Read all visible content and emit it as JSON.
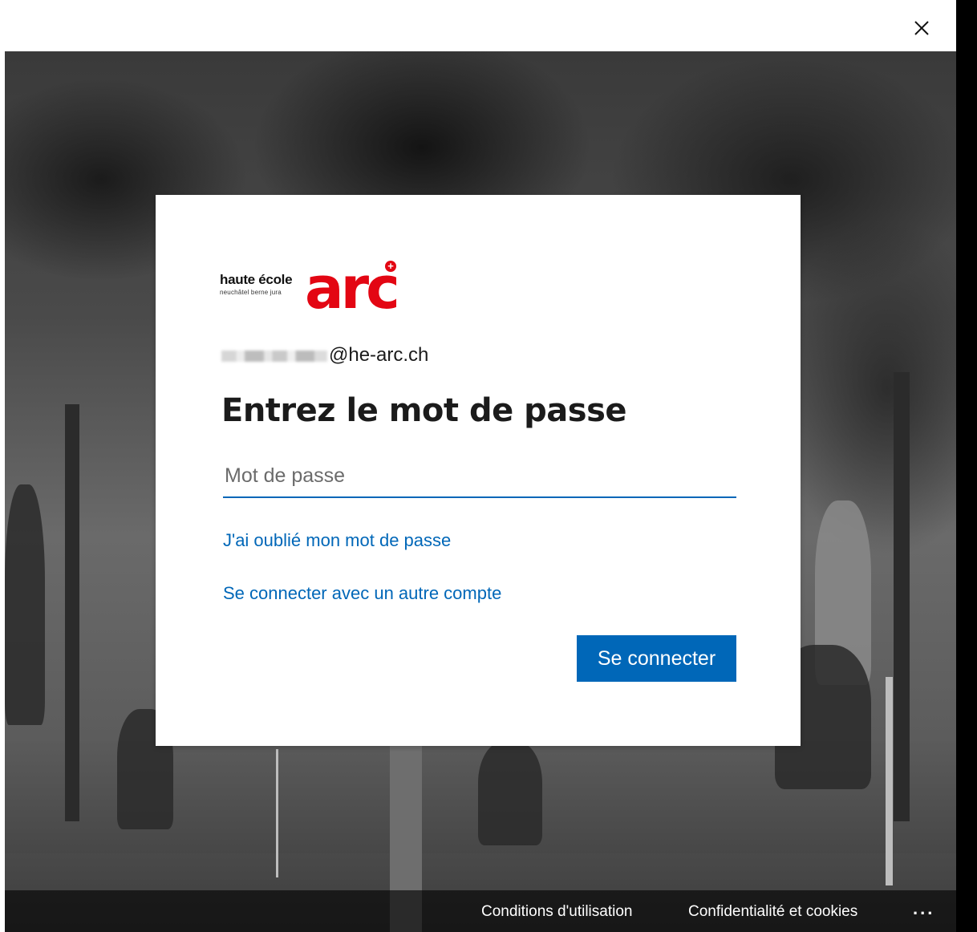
{
  "window": {
    "close_icon": "close-icon"
  },
  "logo": {
    "main_text": "haute école",
    "sub_text": "neuchâtel berne jura",
    "brand_text": "arc",
    "plus_symbol": "+",
    "brand_color": "#e30613"
  },
  "account": {
    "email_domain": "@he-arc.ch"
  },
  "form": {
    "title": "Entrez le mot de passe",
    "password_placeholder": "Mot de passe",
    "password_value": "",
    "forgot_link": "J'ai oublié mon mot de passe",
    "other_account_link": "Se connecter avec un autre compte",
    "submit_label": "Se connecter",
    "accent_color": "#0067b8"
  },
  "footer": {
    "terms": "Conditions d'utilisation",
    "privacy": "Confidentialité et cookies",
    "more": "..."
  }
}
